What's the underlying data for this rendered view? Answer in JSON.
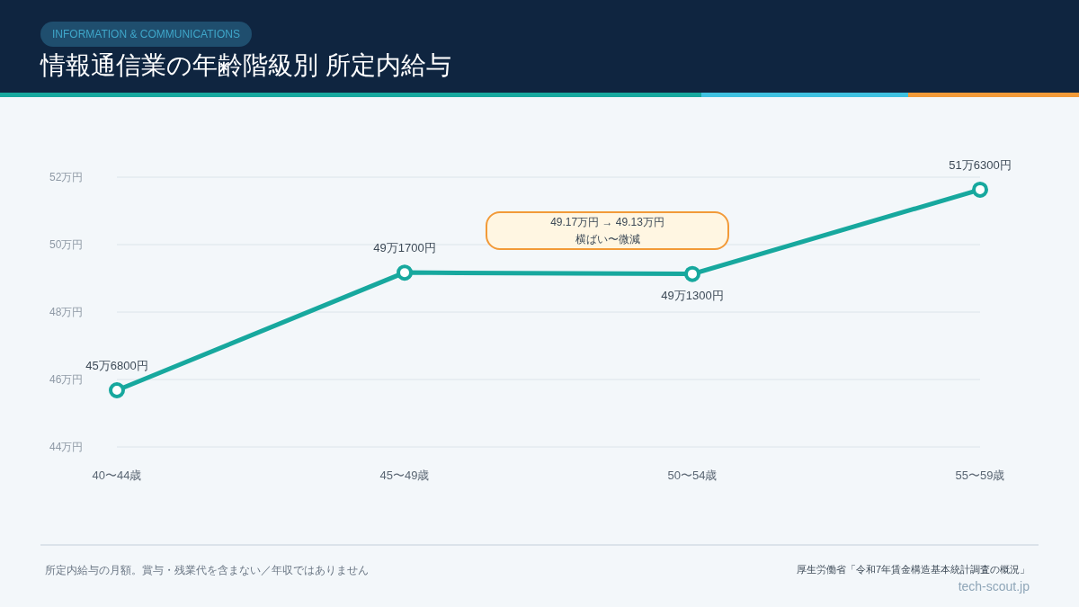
{
  "header": {
    "badge": "INFORMATION & COMMUNICATIONS",
    "title": "情報通信業の年齢階級別 所定内給与"
  },
  "chart": {
    "chart_data": {
      "type": "line",
      "categories": [
        "40〜44歳",
        "45〜49歳",
        "50〜54歳",
        "55〜59歳"
      ],
      "series": [
        {
          "color": "#17a89e",
          "marker": "circle",
          "values": [
            45.68,
            49.17,
            49.13,
            51.63
          ]
        }
      ],
      "grid": true,
      "ylim": [
        44,
        52
      ],
      "yticks": [
        {
          "value": 44,
          "label": "44万円"
        },
        {
          "value": 46,
          "label": "46万円"
        },
        {
          "value": 48,
          "label": "48万円"
        },
        {
          "value": 50,
          "label": "50万円"
        },
        {
          "value": 52,
          "label": "52万円"
        }
      ],
      "value_labels": [
        "45万6800円",
        "49万1700円",
        "49万1300円",
        "51万6300円"
      ],
      "annotations": [
        {
          "text": "49.17万円 → 49.13万円"
        },
        {
          "text": "横ばい〜微減"
        }
      ]
    }
  },
  "footer": {
    "note": "所定内給与の月額。賞与・残業代を含まない／年収ではありません",
    "source": "厚生労働省「令和7年賃金構造基本統計調査の概況」",
    "site": "tech-scout.jp"
  }
}
